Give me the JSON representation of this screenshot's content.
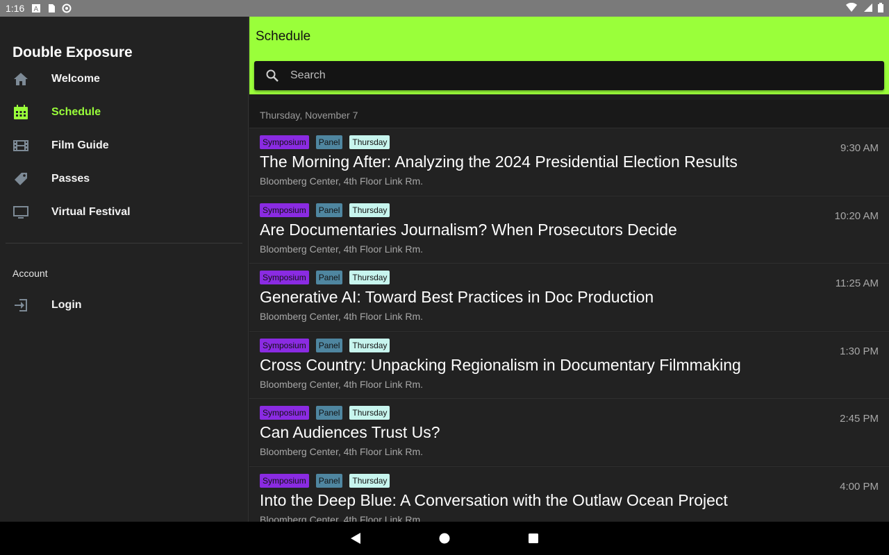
{
  "status": {
    "time": "1:16"
  },
  "drawer": {
    "title": "Double Exposure",
    "items": [
      {
        "label": "Welcome",
        "icon": "home-icon"
      },
      {
        "label": "Schedule",
        "icon": "calendar-icon",
        "active": true
      },
      {
        "label": "Film Guide",
        "icon": "film-icon"
      },
      {
        "label": "Passes",
        "icon": "tag-icon"
      },
      {
        "label": "Virtual Festival",
        "icon": "monitor-icon"
      }
    ],
    "account_label": "Account",
    "login_label": "Login"
  },
  "appbar": {
    "title": "Schedule",
    "search_placeholder": "Search"
  },
  "schedule": {
    "date_header": "Thursday, November 7",
    "tags": [
      "Symposium",
      "Panel",
      "Thursday"
    ],
    "events": [
      {
        "title": "The Morning After: Analyzing the 2024 Presidential Election Results",
        "location": "Bloomberg Center, 4th Floor Link Rm.",
        "time": "9:30 AM"
      },
      {
        "title": "Are Documentaries Journalism? When Prosecutors Decide",
        "location": "Bloomberg Center, 4th Floor Link Rm.",
        "time": "10:20 AM"
      },
      {
        "title": "Generative AI: Toward Best Practices in Doc Production",
        "location": "Bloomberg Center, 4th Floor Link Rm.",
        "time": "11:25 AM"
      },
      {
        "title": "Cross Country: Unpacking Regionalism in Documentary Filmmaking",
        "location": "Bloomberg Center, 4th Floor Link Rm.",
        "time": "1:30 PM"
      },
      {
        "title": "Can Audiences Trust Us?",
        "location": "Bloomberg Center, 4th Floor Link Rm.",
        "time": "2:45 PM"
      },
      {
        "title": "Into the Deep Blue: A Conversation with the Outlaw Ocean Project",
        "location": "Bloomberg Center, 4th Floor Link Rm.",
        "time": "4:00 PM"
      }
    ]
  },
  "colors": {
    "accent": "#9aff3a",
    "symposium": "#8a2be2",
    "panel": "#4f86a0",
    "thursday": "#c7f5ee"
  }
}
